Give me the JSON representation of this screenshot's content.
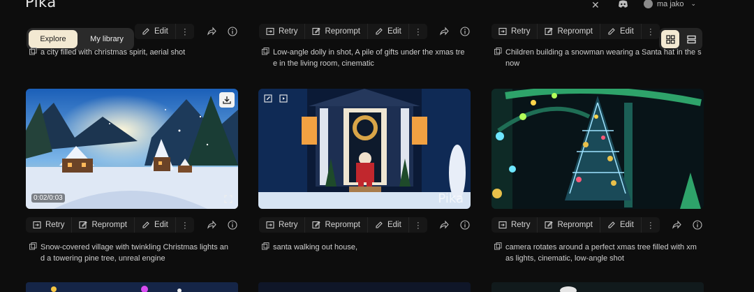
{
  "app": {
    "logo": "Pika"
  },
  "header": {
    "user_name": "ma jako"
  },
  "tabs": {
    "explore": "Explore",
    "my_library": "My library"
  },
  "actions": {
    "retry": "Retry",
    "reprompt": "Reprompt",
    "edit": "Edit"
  },
  "rows": [
    {
      "cards": [
        {
          "caption_l1": "a city filled with christmas spirit, aerial shot",
          "caption_l2": ""
        },
        {
          "caption_l1": "Low-angle dolly in shot, A pile of gifts under the xmas tre",
          "caption_l2": "e in the living room, cinematic"
        },
        {
          "caption_l1": "Children building a snowman wearing a Santa hat in the s",
          "caption_l2": "now"
        }
      ]
    },
    {
      "cards": [
        {
          "caption_l1": "Snow-covered village with twinkling Christmas lights an",
          "caption_l2": "d a towering pine tree, unreal engine",
          "time": "0:02/0:03"
        },
        {
          "caption_l1": "santa walking out house,",
          "caption_l2": "",
          "watermark": "Pika"
        },
        {
          "caption_l1": "camera rotates around a perfect xmas tree filled with xm",
          "caption_l2": "as lights, cinematic, low-angle shot"
        }
      ]
    }
  ]
}
